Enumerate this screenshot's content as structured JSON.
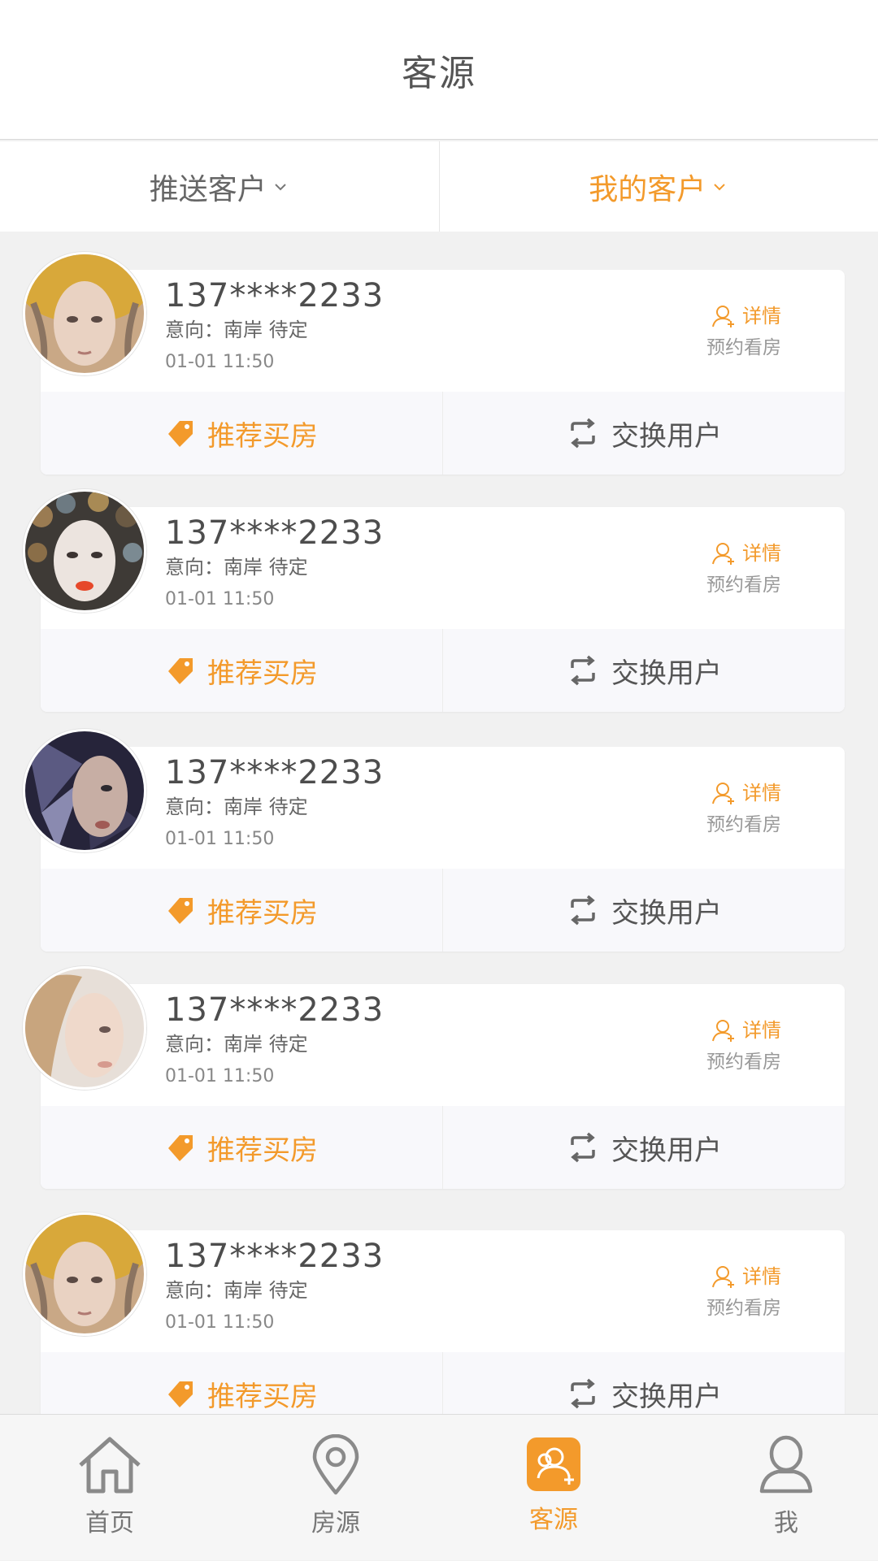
{
  "header": {
    "title": "客源"
  },
  "tabs": [
    {
      "label": "推送客户",
      "active": false
    },
    {
      "label": "我的客户",
      "active": true
    }
  ],
  "colors": {
    "accent": "#f39a2b",
    "text": "#555555",
    "background": "#f1f1f1"
  },
  "customers": [
    {
      "phone": "137****2233",
      "intent": "意向：南岸 待定",
      "time": "01-01 11:50",
      "detail": "详情",
      "appointment": "预约看房",
      "recommend": "推荐买房",
      "exchange": "交换用户",
      "avatar": "woman-golden-leaves-avatar"
    },
    {
      "phone": "137****2233",
      "intent": "意向：南岸 待定",
      "time": "01-01 11:50",
      "detail": "详情",
      "appointment": "预约看房",
      "recommend": "推荐买房",
      "exchange": "交换用户",
      "avatar": "woman-butterfly-crown-avatar"
    },
    {
      "phone": "137****2233",
      "intent": "意向：南岸 待定",
      "time": "01-01 11:50",
      "detail": "详情",
      "appointment": "预约看房",
      "recommend": "推荐买房",
      "exchange": "交换用户",
      "avatar": "woman-butterfly-mask-avatar"
    },
    {
      "phone": "137****2233",
      "intent": "意向：南岸 待定",
      "time": "01-01 11:50",
      "detail": "详情",
      "appointment": "预约看房",
      "recommend": "推荐买房",
      "exchange": "交换用户",
      "avatar": "blonde-woman-profile-avatar"
    },
    {
      "phone": "137****2233",
      "intent": "意向：南岸 待定",
      "time": "01-01 11:50",
      "detail": "详情",
      "appointment": "预约看房",
      "recommend": "推荐买房",
      "exchange": "交换用户",
      "avatar": "woman-golden-leaves-avatar"
    }
  ],
  "nav": [
    {
      "label": "首页",
      "icon": "home-icon",
      "active": false
    },
    {
      "label": "房源",
      "icon": "location-pin-icon",
      "active": false
    },
    {
      "label": "客源",
      "icon": "customers-icon",
      "active": true
    },
    {
      "label": "我",
      "icon": "user-icon",
      "active": false
    }
  ]
}
